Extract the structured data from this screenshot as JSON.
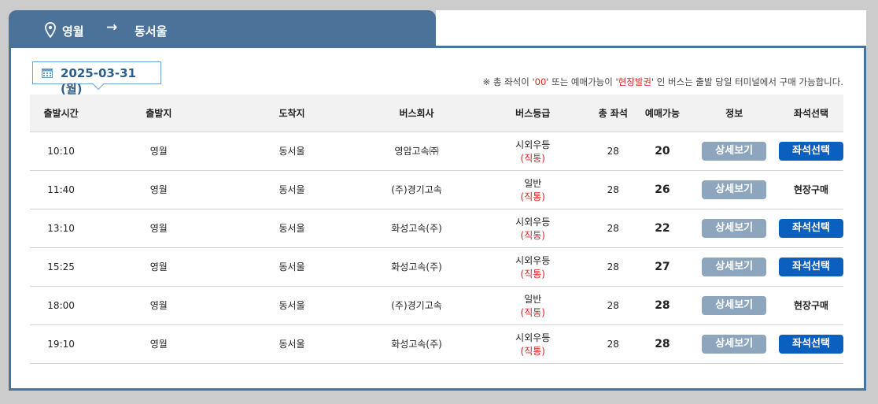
{
  "route": {
    "origin": "영월",
    "arrow": "→",
    "destination": "동서울"
  },
  "date": "2025-03-31 (월)",
  "notice": {
    "part1": "※ 총 좌석이 '",
    "zero": "00",
    "part2": "' 또는 예매가능이 '",
    "onsite": "현장발권",
    "part3": "' 인 버스는 출발 당일 터미널에서 구매 가능합니다."
  },
  "columns": [
    "출발시간",
    "출발지",
    "도착지",
    "버스회사",
    "버스등급",
    "총 좌석",
    "예매가능",
    "정보",
    "좌석선택"
  ],
  "rows": [
    {
      "time": "10:10",
      "from": "영월",
      "to": "동서울",
      "company": "영암고속㈜",
      "grade": "시외우등",
      "grade_sub": "(직통)",
      "total": "28",
      "avail": "20",
      "detail": "상세보기",
      "action": "좌석선택",
      "action_type": "button"
    },
    {
      "time": "11:40",
      "from": "영월",
      "to": "동서울",
      "company": "(주)경기고속",
      "grade": "일반",
      "grade_sub": "(직통)",
      "total": "28",
      "avail": "26",
      "detail": "상세보기",
      "action": "현장구매",
      "action_type": "text"
    },
    {
      "time": "13:10",
      "from": "영월",
      "to": "동서울",
      "company": "화성고속(주)",
      "grade": "시외우등",
      "grade_sub": "(직통)",
      "total": "28",
      "avail": "22",
      "detail": "상세보기",
      "action": "좌석선택",
      "action_type": "button"
    },
    {
      "time": "15:25",
      "from": "영월",
      "to": "동서울",
      "company": "화성고속(주)",
      "grade": "시외우등",
      "grade_sub": "(직통)",
      "total": "28",
      "avail": "27",
      "detail": "상세보기",
      "action": "좌석선택",
      "action_type": "button"
    },
    {
      "time": "18:00",
      "from": "영월",
      "to": "동서울",
      "company": "(주)경기고속",
      "grade": "일반",
      "grade_sub": "(직통)",
      "total": "28",
      "avail": "28",
      "detail": "상세보기",
      "action": "현장구매",
      "action_type": "text"
    },
    {
      "time": "19:10",
      "from": "영월",
      "to": "동서울",
      "company": "화성고속(주)",
      "grade": "시외우등",
      "grade_sub": "(직통)",
      "total": "28",
      "avail": "28",
      "detail": "상세보기",
      "action": "좌석선택",
      "action_type": "button"
    }
  ],
  "colors": {
    "header": "#4b7299",
    "detail_button": "#8ea6bd",
    "seat_button": "#0b5fbf",
    "accent_red": "#e02020"
  }
}
